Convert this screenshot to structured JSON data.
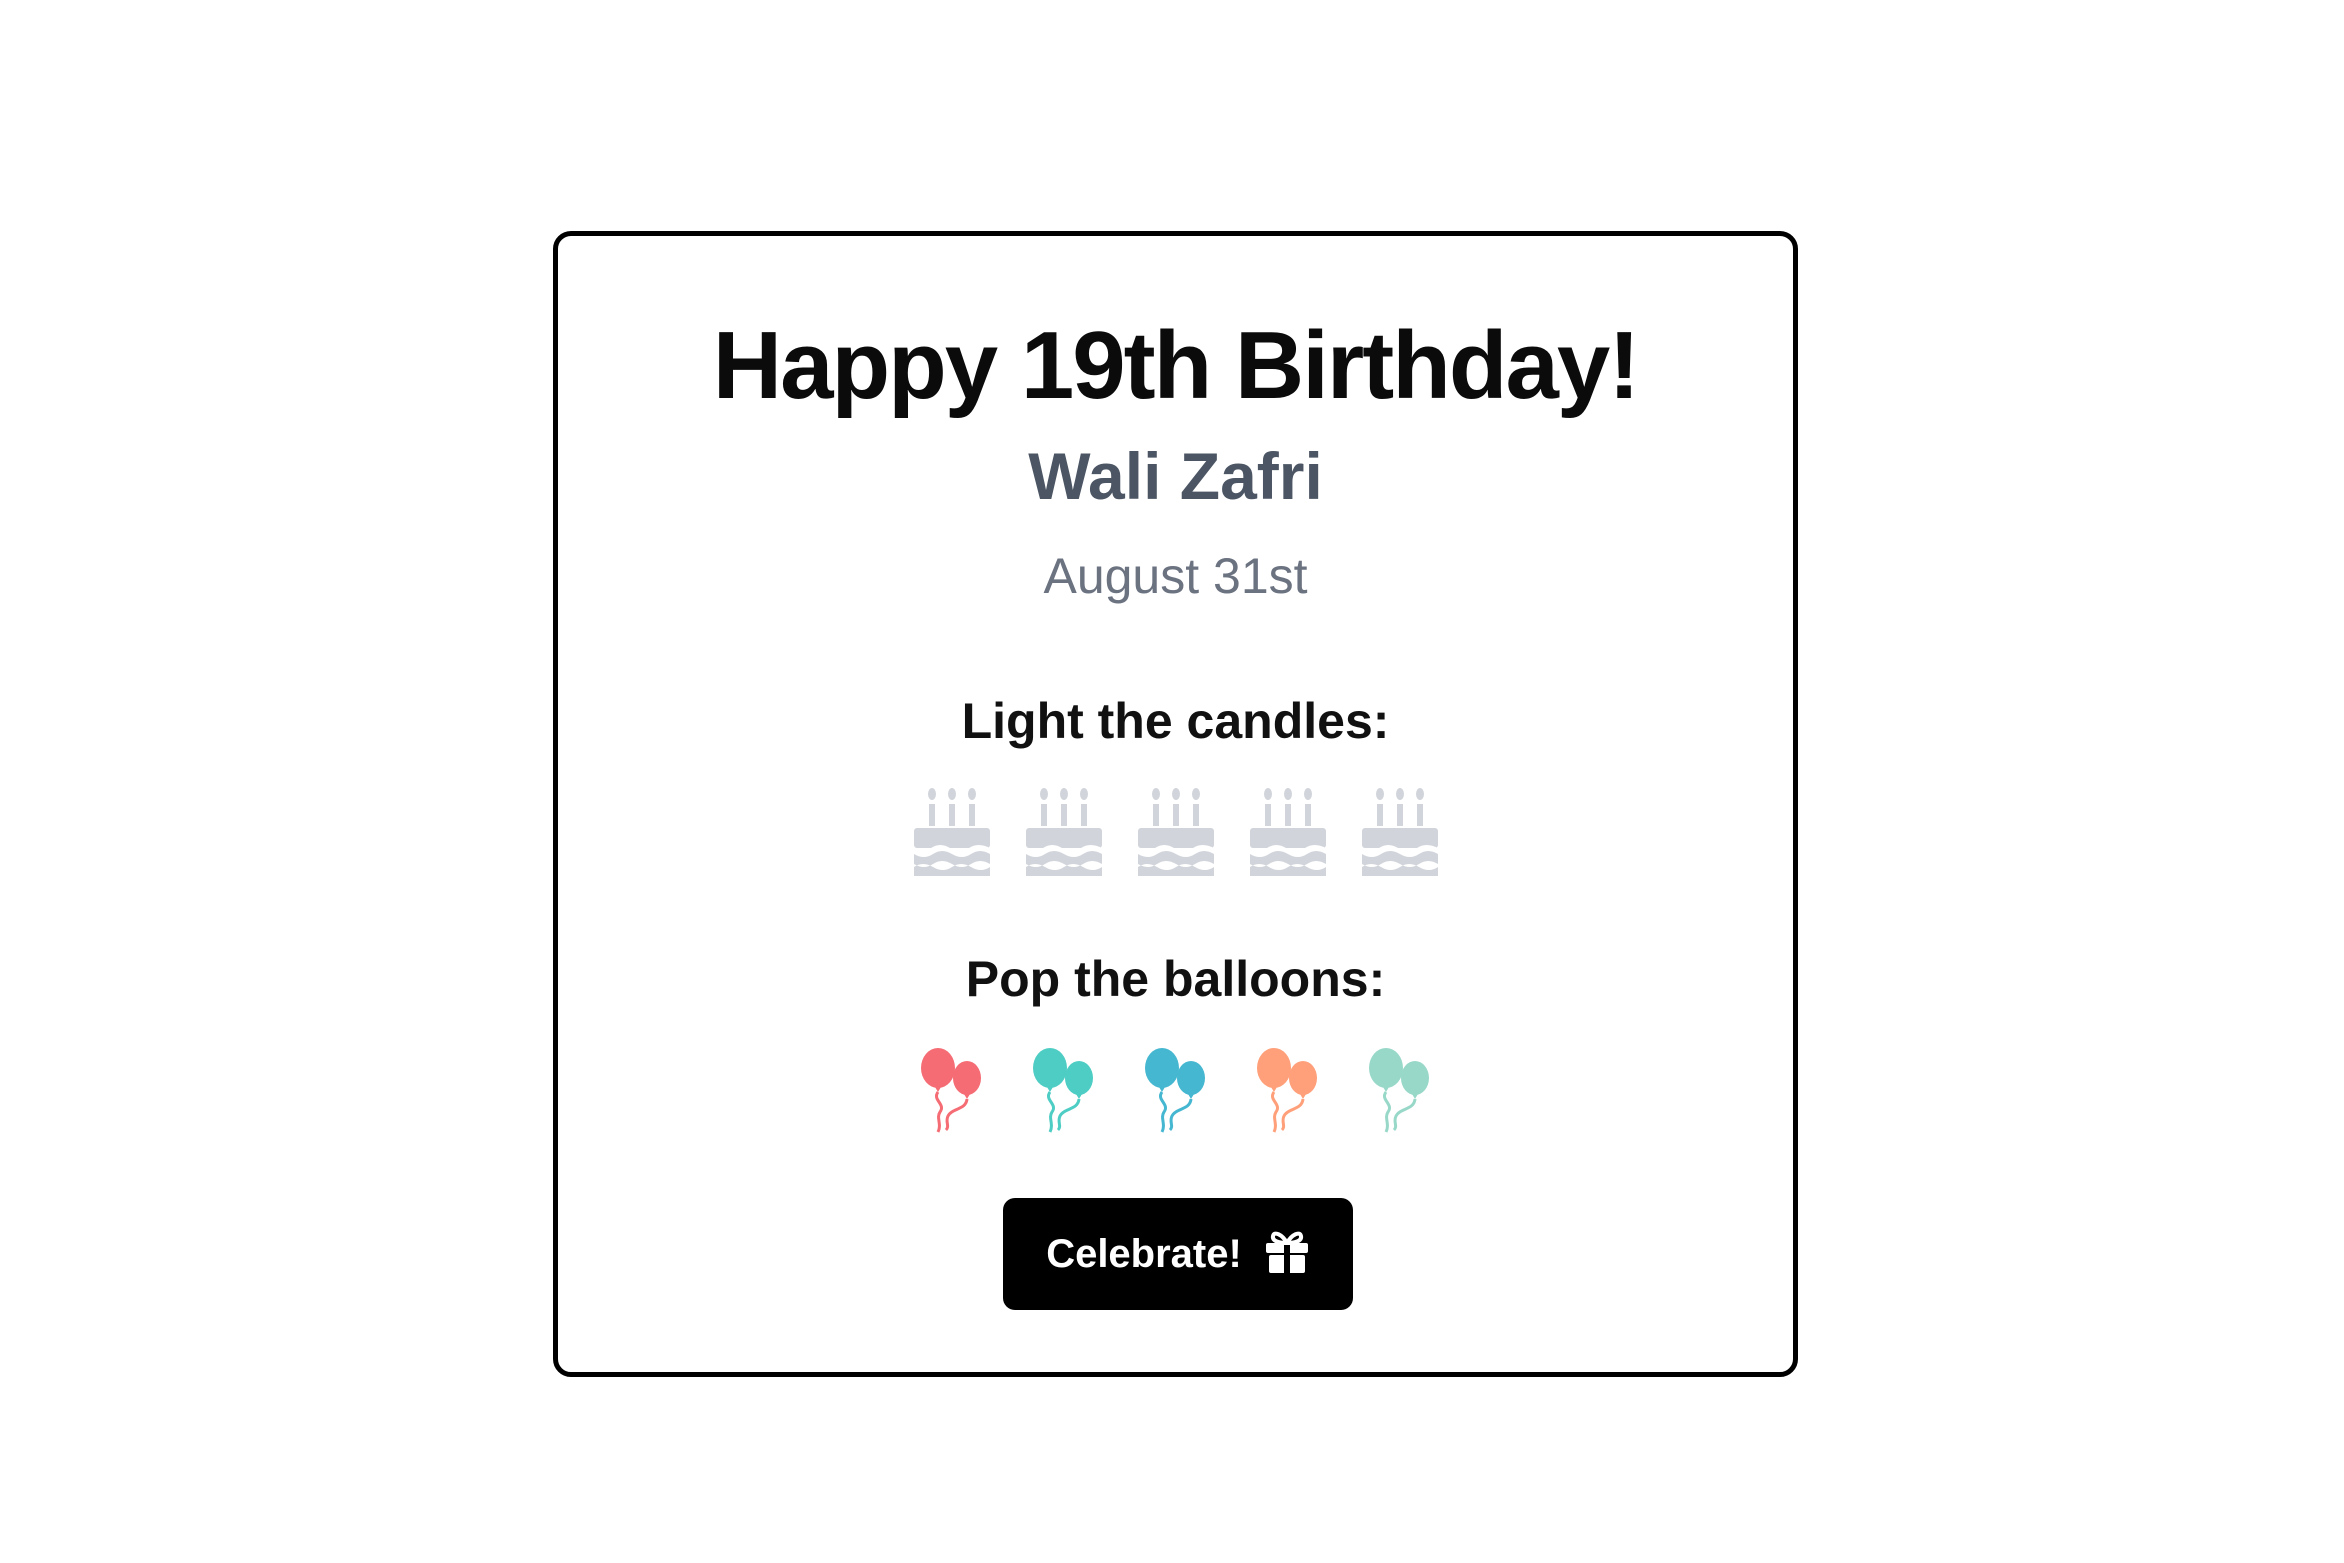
{
  "card": {
    "title": "Happy 19th Birthday!",
    "name": "Wali Zafri",
    "date": "August 31st"
  },
  "candles": {
    "label": "Light the candles:",
    "count": 5,
    "icon": "birthday-cake-icon",
    "color": "#d1d5db"
  },
  "balloons": {
    "label": "Pop the balloons:",
    "icon": "balloons-icon",
    "colors": [
      "#f56c74",
      "#4ecdc4",
      "#45b7d1",
      "#ffa07a",
      "#98d8c8"
    ]
  },
  "celebrate_button": {
    "label": "Celebrate!",
    "icon": "gift-icon"
  }
}
